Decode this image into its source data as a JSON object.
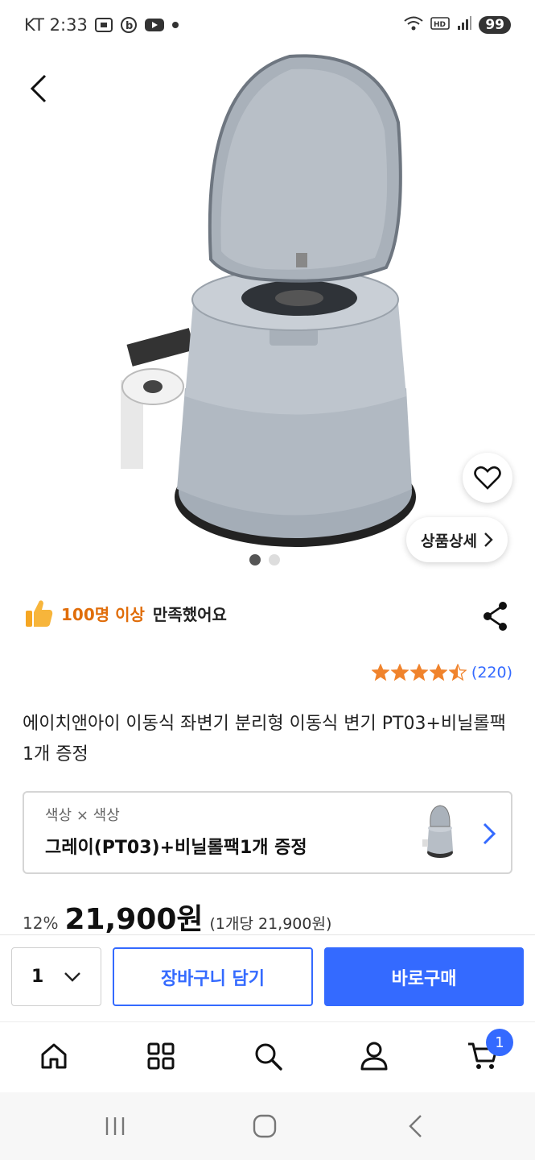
{
  "status_bar": {
    "carrier_time": "KT 2:33",
    "battery": "99",
    "icons": [
      "screenshot-icon",
      "b-app-icon",
      "youtube-icon",
      "dot-icon",
      "wifi-icon",
      "hd-icon",
      "signal-icon"
    ]
  },
  "product": {
    "satisfaction_highlight": "100명 이상",
    "satisfaction_rest": "만족했어요",
    "rating_stars": 4.5,
    "rating_count": "(220)",
    "title": "에이치앤아이 이동식 좌변기 분리형 이동식 변기 PT03+비닐롤팩1개 증정",
    "detail_button": "상품상세",
    "image_pages": 2,
    "image_current": 1
  },
  "option": {
    "label": "색상 × 색상",
    "value": "그레이(PT03)+비닐롤팩1개 증정"
  },
  "price": {
    "discount": "12%",
    "amount": "21,900원",
    "unit": "(1개당 21,900원)"
  },
  "purchase": {
    "quantity": "1",
    "cart_add_label": "장바구니 담기",
    "buy_label": "바로구매"
  },
  "bottom_nav": {
    "items": [
      "home-icon",
      "category-icon",
      "search-icon",
      "profile-icon",
      "cart-icon"
    ],
    "cart_badge": "1"
  },
  "colors": {
    "accent": "#346aff",
    "highlight": "#e06d0a",
    "star": "#f0832c"
  }
}
